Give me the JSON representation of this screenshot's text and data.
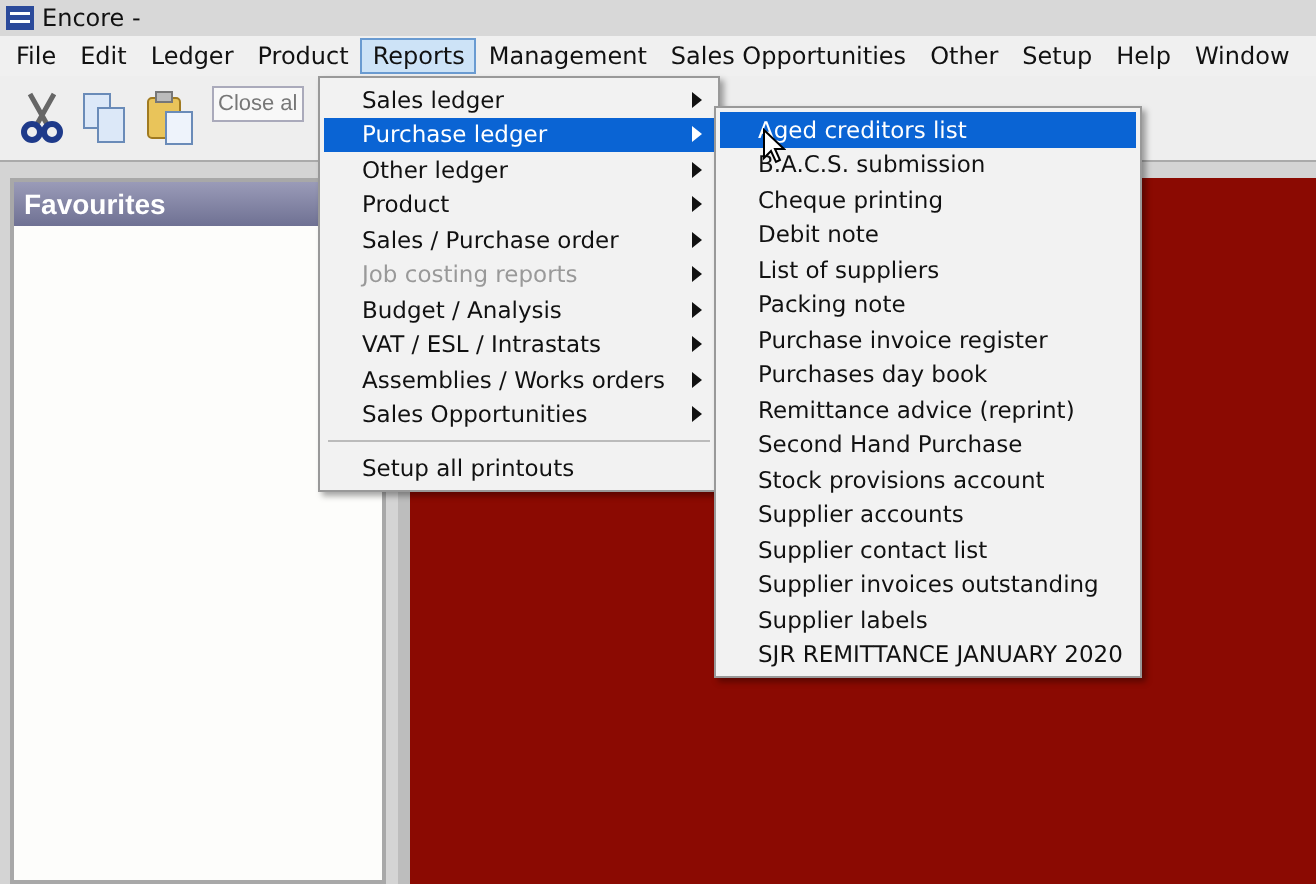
{
  "window": {
    "title": "Encore -"
  },
  "menu_bar": [
    {
      "label": "File",
      "selected": false
    },
    {
      "label": "Edit",
      "selected": false
    },
    {
      "label": "Ledger",
      "selected": false
    },
    {
      "label": "Product",
      "selected": false
    },
    {
      "label": "Reports",
      "selected": true
    },
    {
      "label": "Management",
      "selected": false
    },
    {
      "label": "Sales Opportunities",
      "selected": false
    },
    {
      "label": "Other",
      "selected": false
    },
    {
      "label": "Setup",
      "selected": false
    },
    {
      "label": "Help",
      "selected": false
    },
    {
      "label": "Window",
      "selected": false
    }
  ],
  "toolbar": {
    "close_button": "Close al"
  },
  "favourites": {
    "title": "Favourites"
  },
  "reports_menu": [
    {
      "label": "Sales ledger",
      "submenu": true,
      "selected": false,
      "disabled": false
    },
    {
      "label": "Purchase ledger",
      "submenu": true,
      "selected": true,
      "disabled": false
    },
    {
      "label": "Other ledger",
      "submenu": true,
      "selected": false,
      "disabled": false
    },
    {
      "label": "Product",
      "submenu": true,
      "selected": false,
      "disabled": false
    },
    {
      "label": "Sales / Purchase order",
      "submenu": true,
      "selected": false,
      "disabled": false
    },
    {
      "label": "Job costing reports",
      "submenu": true,
      "selected": false,
      "disabled": true
    },
    {
      "label": "Budget / Analysis",
      "submenu": true,
      "selected": false,
      "disabled": false
    },
    {
      "label": "VAT / ESL / Intrastats",
      "submenu": true,
      "selected": false,
      "disabled": false
    },
    {
      "label": "Assemblies / Works orders",
      "submenu": true,
      "selected": false,
      "disabled": false
    },
    {
      "label": "Sales Opportunities",
      "submenu": true,
      "selected": false,
      "disabled": false
    },
    {
      "label": "Setup all printouts",
      "submenu": false,
      "selected": false,
      "disabled": false,
      "separator_before": true
    }
  ],
  "purchase_ledger_menu": [
    {
      "label": "Aged creditors list",
      "selected": true
    },
    {
      "label": "B.A.C.S. submission",
      "selected": false
    },
    {
      "label": "Cheque printing",
      "selected": false
    },
    {
      "label": "Debit note",
      "selected": false
    },
    {
      "label": "List of suppliers",
      "selected": false
    },
    {
      "label": "Packing note",
      "selected": false
    },
    {
      "label": "Purchase invoice register",
      "selected": false
    },
    {
      "label": "Purchases day book",
      "selected": false
    },
    {
      "label": "Remittance advice (reprint)",
      "selected": false
    },
    {
      "label": "Second Hand Purchase",
      "selected": false
    },
    {
      "label": "Stock provisions account",
      "selected": false
    },
    {
      "label": "Supplier accounts",
      "selected": false
    },
    {
      "label": "Supplier contact list",
      "selected": false
    },
    {
      "label": "Supplier invoices outstanding",
      "selected": false
    },
    {
      "label": "Supplier labels",
      "selected": false
    },
    {
      "label": "SJR REMITTANCE JANUARY 2020",
      "selected": false
    }
  ]
}
